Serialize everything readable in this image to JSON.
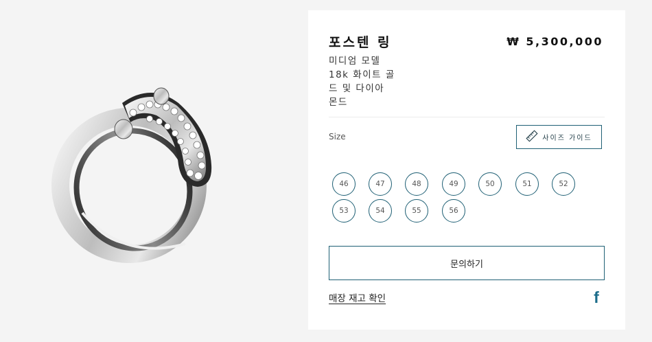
{
  "product": {
    "title": "포스텐 링",
    "price": "₩ 5,300,000",
    "description_lines": [
      "미디엄 모델",
      "18k 화이트 골",
      "드 및 다이아",
      "몬드"
    ]
  },
  "size": {
    "label": "Size",
    "guide_label": "사이즈 가이드",
    "options": [
      "46",
      "47",
      "48",
      "49",
      "50",
      "51",
      "52",
      "53",
      "54",
      "55",
      "56"
    ]
  },
  "actions": {
    "inquiry_label": "문의하기",
    "stock_link": "매장 재고 확인"
  },
  "social": {
    "facebook_glyph": "f",
    "icon": "facebook-icon"
  },
  "colors": {
    "accent": "#1e5f74",
    "background": "#f4f4f4",
    "panel": "#ffffff"
  }
}
